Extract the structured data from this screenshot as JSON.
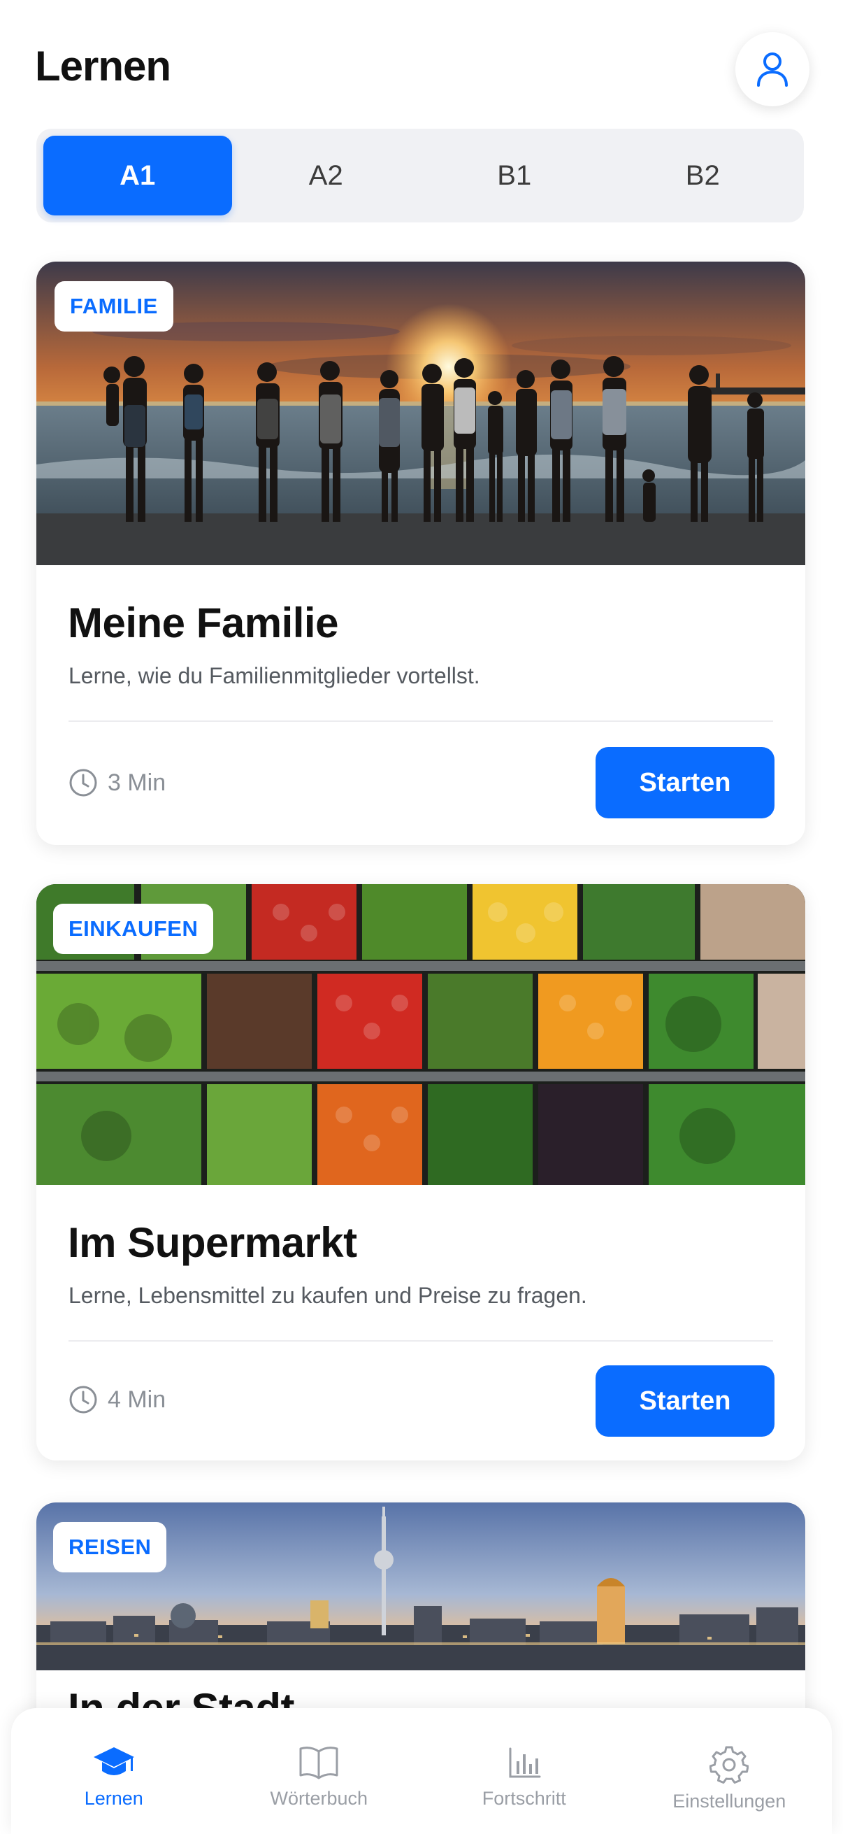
{
  "header": {
    "title": "Lernen",
    "profile_icon": "user-icon"
  },
  "levels": [
    {
      "label": "A1",
      "active": true
    },
    {
      "label": "A2",
      "active": false
    },
    {
      "label": "B1",
      "active": false
    },
    {
      "label": "B2",
      "active": false
    }
  ],
  "cards": [
    {
      "tag": "FAMILIE",
      "title": "Meine Familie",
      "description": "Lerne, wie du Familienmitglieder vortellst.",
      "duration": "3 Min",
      "button": "Starten",
      "image": "family-sunset-beach"
    },
    {
      "tag": "EINKAUFEN",
      "title": "Im Supermarkt",
      "description": "Lerne, Lebensmittel zu kaufen und Preise zu fragen.",
      "duration": "4 Min",
      "button": "Starten",
      "image": "supermarket-produce"
    },
    {
      "tag": "REISEN",
      "title": "In der Stadt",
      "image": "berlin-skyline"
    }
  ],
  "nav": [
    {
      "label": "Lernen",
      "icon": "graduation-cap-icon",
      "active": true
    },
    {
      "label": "Wörterbuch",
      "icon": "book-icon",
      "active": false
    },
    {
      "label": "Fortschritt",
      "icon": "bar-chart-icon",
      "active": false
    },
    {
      "label": "Einstellungen",
      "icon": "gear-icon",
      "active": false
    }
  ],
  "colors": {
    "accent": "#0a6cff",
    "background": "#ffffff",
    "muted": "#9a9ea5"
  }
}
